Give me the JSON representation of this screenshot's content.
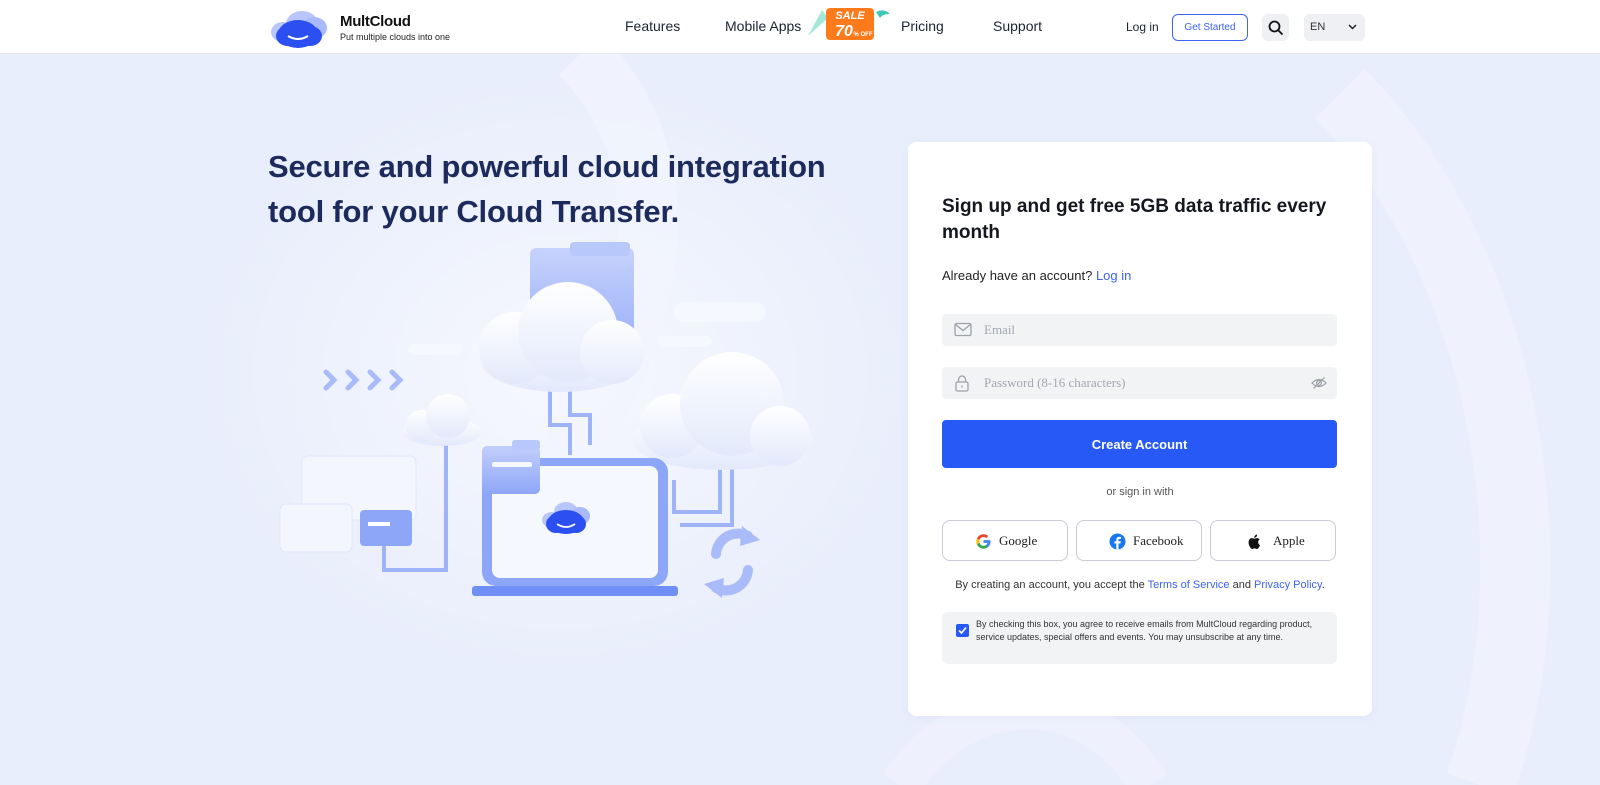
{
  "header": {
    "logo": {
      "name": "MultCloud",
      "tagline": "Put multiple clouds into one"
    },
    "nav": [
      {
        "label": "Features"
      },
      {
        "label": "Mobile Apps"
      },
      {
        "label": "Pricing"
      },
      {
        "label": "Support"
      }
    ],
    "sale_badge": {
      "line1": "SALE",
      "line2": "70",
      "line3": "% OFF"
    },
    "login_label": "Log in",
    "get_started_label": "Get Started",
    "language": "EN"
  },
  "hero": {
    "title_line1": "Secure and powerful cloud integration",
    "title_line2": "tool for your Cloud Transfer."
  },
  "signup": {
    "title": "Sign up and get free 5GB data traffic every month",
    "have_account_text": "Already have an account?",
    "login_link": "Log in",
    "email_placeholder": "Email",
    "password_placeholder": "Password (8-16 characters)",
    "create_button": "Create Account",
    "or_text": "or sign in with",
    "social": [
      {
        "label": "Google"
      },
      {
        "label": "Facebook"
      },
      {
        "label": "Apple"
      }
    ],
    "terms": {
      "prefix": "By creating an account, you accept the",
      "terms_link": "Terms of Service",
      "and": "and",
      "privacy_link": "Privacy Policy",
      "suffix": "."
    },
    "consent": {
      "checked": true,
      "text": "By checking this box, you agree to receive emails from MultCloud regarding product, service updates, special offers and events. You may unsubscribe at any time."
    }
  },
  "colors": {
    "accent": "#2659f5",
    "link": "#3e63f5",
    "page_bg": "#e9eefc",
    "hero_title": "#1c2a5c"
  },
  "icons": [
    "multcloud-logo-icon",
    "search-icon",
    "chevron-down-icon",
    "mail-icon",
    "lock-icon",
    "eye-off-icon",
    "google-icon",
    "facebook-icon",
    "apple-icon",
    "checkmark-icon"
  ]
}
